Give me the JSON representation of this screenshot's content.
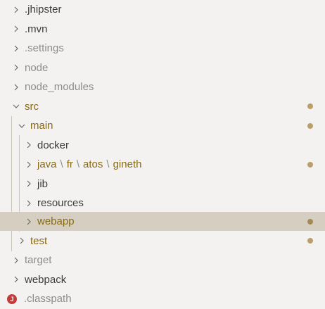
{
  "tree": {
    "items": [
      {
        "label": ".jhipster"
      },
      {
        "label": ".mvn"
      },
      {
        "label": ".settings"
      },
      {
        "label": "node"
      },
      {
        "label": "node_modules"
      },
      {
        "label": "src"
      },
      {
        "label": "main"
      },
      {
        "label": "docker"
      },
      {
        "label": "java",
        "path": [
          "java",
          "fr",
          "atos",
          "gineth"
        ],
        "separator": "\\"
      },
      {
        "label": "jib"
      },
      {
        "label": "resources"
      },
      {
        "label": "webapp"
      },
      {
        "label": "test"
      },
      {
        "label": "target"
      },
      {
        "label": "webpack"
      },
      {
        "label": ".classpath",
        "badge": "J"
      }
    ]
  },
  "colors": {
    "background": "#f3f2f1",
    "selected_row": "#d6cfc1",
    "modified_text": "#8a6a12",
    "ignored_text": "#8c8c8c",
    "modified_dot": "#b9a06a"
  }
}
